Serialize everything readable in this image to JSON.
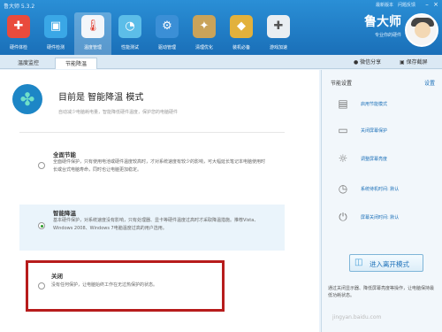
{
  "window": {
    "title": "鲁大师 5.3.2"
  },
  "top_links": [
    "最新版本",
    "问题反馈"
  ],
  "nav": [
    {
      "label": "硬件体检",
      "icon": "health-check-icon",
      "glyph": "✚"
    },
    {
      "label": "硬件检测",
      "icon": "hardware-detect-icon",
      "glyph": "▣"
    },
    {
      "label": "温度管理",
      "icon": "thermometer-icon",
      "glyph": "🌡"
    },
    {
      "label": "性能测试",
      "icon": "speedometer-icon",
      "glyph": "◔"
    },
    {
      "label": "驱动管理",
      "icon": "driver-gear-icon",
      "glyph": "⚙"
    },
    {
      "label": "清理优化",
      "icon": "broom-icon",
      "glyph": "✦"
    },
    {
      "label": "装机必备",
      "icon": "box-icon",
      "glyph": "◆"
    },
    {
      "label": "游戏加速",
      "icon": "gamepad-icon",
      "glyph": "✚"
    }
  ],
  "brand": {
    "name": "鲁大师",
    "slogan": "专业你的硬件"
  },
  "tabs": [
    "温度监控",
    "节能降温"
  ],
  "tab_links": [
    "微信分享",
    "保存截屏"
  ],
  "header": {
    "title": "目前是 智能降温 模式",
    "subtitle": "自动减少电脑耗电量，智能降低硬件温度，保护您的电脑硬件"
  },
  "options": [
    {
      "title": "全面节能",
      "desc": "全面硬件保护，只有使用电池或硬件温度较高时，才对系统速度有较少的影响，可大幅延长笔记本电脑使用时长或台式电脑寿命，同时也让电脑更加稳定。",
      "selected": false
    },
    {
      "title": "智能降温",
      "desc": "基本硬件保护，对系统速度没有影响，只有处理器、显卡等硬件温度过高时才采取降温措施。推荐Vista、Windows 2008、Windows 7电脑温度过高的用户选用。",
      "selected": true
    },
    {
      "title": "关闭",
      "desc": "没有任何保护，让电脑始终工作在无过热保护的状态。",
      "selected": false
    }
  ],
  "side": {
    "title": "节能设置",
    "link": "设置",
    "items": [
      {
        "label": "启用节能模式",
        "icon": "power-save-icon",
        "glyph": "▤"
      },
      {
        "label": "关闭屏幕保护",
        "icon": "monitor-icon",
        "glyph": "▭"
      },
      {
        "label": "调整屏幕亮度",
        "icon": "brightness-icon",
        "glyph": "☼"
      },
      {
        "label": "系统待机时间: 默认",
        "icon": "clock-icon",
        "glyph": "◷"
      },
      {
        "label": "屏幕关闭时间: 默认",
        "icon": "power-icon",
        "glyph": "⏻"
      }
    ],
    "mode_button": "进入离开模式",
    "note": "通过关闭显示器、降低屏幕亮度等操作，让电脑保持最低功耗状态。",
    "watermark": "jingyan.baidu.com"
  },
  "colors": {
    "accent": "#1a6fb8",
    "highlight_box": "#b71c1c",
    "radio_on": "#2e9e2e"
  }
}
